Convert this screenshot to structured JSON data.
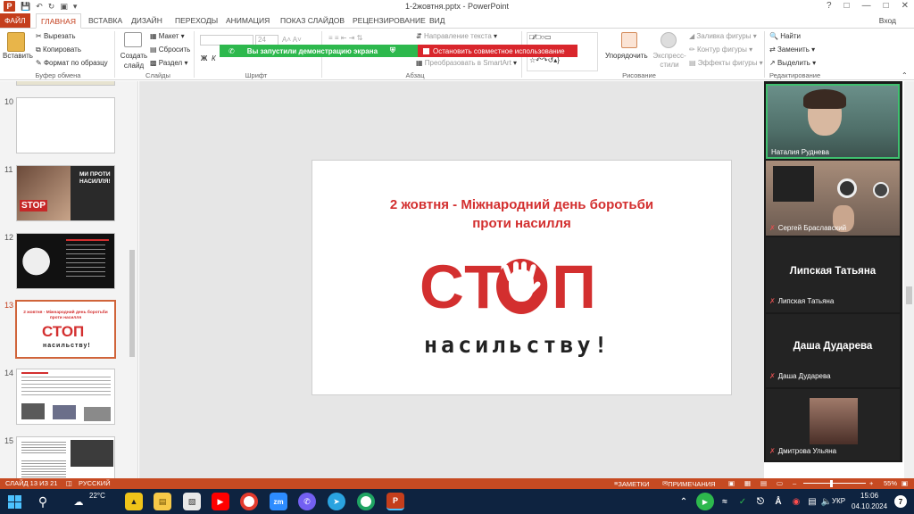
{
  "titlebar": {
    "title": "1-2жовтня.pptx - PowerPoint",
    "help": "?",
    "controls": [
      "—",
      "□",
      "✕"
    ]
  },
  "tabs": {
    "file": "ФАЙЛ",
    "home": "ГЛАВНАЯ",
    "insert": "ВСТАВКА",
    "design": "ДИЗАЙН",
    "transitions": "ПЕРЕХОДЫ",
    "animations": "АНИМАЦИЯ",
    "slideshow": "ПОКАЗ СЛАЙДОВ",
    "review": "РЕЦЕНЗИРОВАНИЕ",
    "view": "ВИД",
    "signin": "Вход"
  },
  "ribbon": {
    "paste": "Вставить",
    "cut": "Вырезать",
    "copy": "Копировать",
    "format_painter": "Формат по образцу",
    "clipboard_group": "Буфер обмена",
    "new_slide": "Создать слайд",
    "layout": "Макет",
    "reset": "Сбросить",
    "section": "Раздел",
    "slides_group": "Слайды",
    "font_group": "Шрифт",
    "font_size": "24",
    "paragraph_group": "Абзац",
    "text_direction": "Направление текста",
    "smartart": "Преобразовать в SmartArt",
    "arrange": "Упорядочить",
    "quick_styles": "Экспресс-стили",
    "shape_fill": "Заливка фигуры",
    "shape_outline": "Контур фигуры",
    "shape_effects": "Эффекты фигуры",
    "drawing_group": "Рисование",
    "find": "Найти",
    "replace": "Заменить",
    "select": "Выделить",
    "editing_group": "Редактирование"
  },
  "share_banner": {
    "message": "Вы запустили демонстрацию экрана",
    "stop": "Остановить совместное использование"
  },
  "thumbnails": {
    "items": [
      {
        "num": "10"
      },
      {
        "num": "11",
        "text1": "МИ ПРОТИ",
        "text2": "НАСИЛЛЯ!",
        "stop": "STOP"
      },
      {
        "num": "12"
      },
      {
        "num": "13",
        "title": "2 жовтня - Міжнародний день боротьби проти насилля",
        "stop": "СТОП",
        "sub": "насильству!"
      },
      {
        "num": "14"
      },
      {
        "num": "15"
      }
    ]
  },
  "slide": {
    "title_line1": "2 жовтня - Міжнародний день боротьби",
    "title_line2": "проти насилля",
    "stop_word": "СТОП",
    "sub_word": "насильству!"
  },
  "participants": [
    {
      "name": "Наталия Руднева",
      "type": "video"
    },
    {
      "name": "Сергей Браславский",
      "type": "video"
    },
    {
      "name": "Липская Татьяна",
      "type": "name"
    },
    {
      "name": "Даша Дударева",
      "type": "name"
    },
    {
      "name": "Дмитрова Ульяна",
      "type": "photo"
    }
  ],
  "statusbar": {
    "slide_counter": "СЛАЙД 13 ИЗ 21",
    "language": "РУССКИЙ",
    "notes": "ЗАМЕТКИ",
    "comments": "ПРИМЕЧАНИЯ",
    "zoom": "55%"
  },
  "taskbar": {
    "weather": "22°C",
    "lang": "УКР",
    "time": "15:06",
    "date": "04.10.2024",
    "notifications": "7"
  },
  "colors": {
    "accent": "#c43e1c",
    "slide_red": "#d32f2f",
    "share_green": "#2db84d",
    "share_red": "#d9262c",
    "taskbar": "#0e2340"
  }
}
